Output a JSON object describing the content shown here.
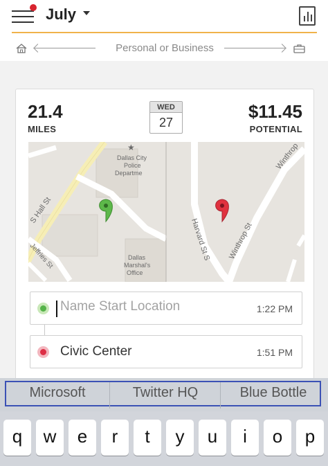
{
  "header": {
    "month_label": "July",
    "icons": {
      "menu": "hamburger-menu-icon",
      "notification": "notification-dot",
      "dropdown": "chevron-down-icon",
      "reports": "bar-chart-report-icon"
    },
    "accent_color": "#f0b34a",
    "notification_color": "#d8242f"
  },
  "classification": {
    "label": "Personal or Business",
    "left_icon": "home-icon",
    "right_icon": "briefcase-icon"
  },
  "drive": {
    "miles_value": "21.4",
    "miles_label": "MILES",
    "date_dow": "WED",
    "date_day": "27",
    "potential_value": "$11.45",
    "potential_label": "POTENTIAL"
  },
  "map": {
    "left_labels": {
      "street1": "S Hall St",
      "street2": "Jeffries St",
      "poi1_line1": "Dallas City",
      "poi1_line2": "Police",
      "poi1_line3": "Departme",
      "poi2_line1": "Dallas",
      "poi2_line2": "Marshal's",
      "poi2_line3": "Office"
    },
    "right_labels": {
      "street1": "Harvard St S",
      "street2": "Winthrop St",
      "street3": "Winthrop"
    },
    "start_pin_color": "#5db84a",
    "end_pin_color": "#e0323f"
  },
  "locations": {
    "start": {
      "placeholder": "Name Start Location",
      "time": "1:22 PM",
      "color": "#55b349"
    },
    "end": {
      "name": "Civic Center",
      "time": "1:51 PM",
      "color": "#dd2e45"
    }
  },
  "suggestions": [
    "Microsoft",
    "Twitter HQ",
    "Blue Bottle"
  ],
  "keyboard": {
    "row1": [
      "q",
      "w",
      "e",
      "r",
      "t",
      "y",
      "u",
      "i",
      "o",
      "p"
    ]
  }
}
